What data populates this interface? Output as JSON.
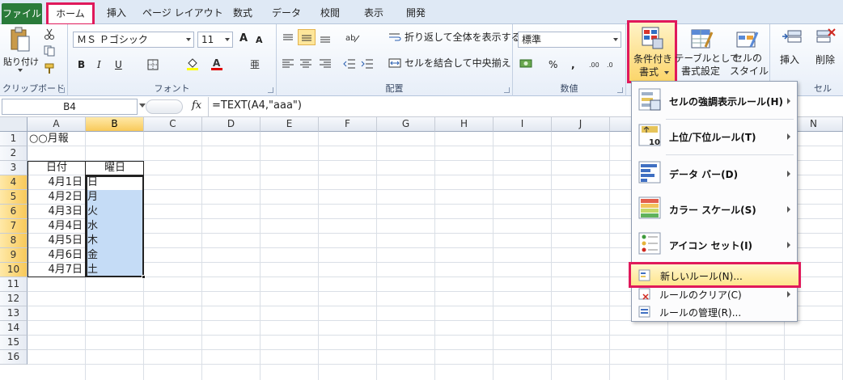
{
  "tabs": [
    "ファイル",
    "ホーム",
    "挿入",
    "ページ レイアウト",
    "数式",
    "データ",
    "校閲",
    "表示",
    "開発"
  ],
  "ribbon": {
    "clipboard": {
      "paste": "貼り付け",
      "label": "クリップボード"
    },
    "font": {
      "name": "ＭＳ Ｐゴシック",
      "size": "11",
      "label": "フォント",
      "bold": "B",
      "italic": "I",
      "underline": "U",
      "grow": "A",
      "shrink": "A"
    },
    "alignment": {
      "wrap": "折り返して全体を表示する",
      "merge": "セルを結合して中央揃え",
      "label": "配置"
    },
    "number": {
      "format": "標準",
      "label": "数値",
      "percent": "%",
      "comma": ","
    },
    "styles": {
      "conditional": [
        "条件付き",
        "書式"
      ],
      "table": [
        "テーブルとして",
        "書式設定"
      ],
      "cell": [
        "セルの",
        "スタイル"
      ]
    },
    "cells": {
      "insert": "挿入",
      "delete": "削除",
      "label": "セル"
    }
  },
  "formula_bar": {
    "name_box": "B4",
    "fx": "fx",
    "formula": "=TEXT(A4,\"aaa\")"
  },
  "columns": [
    "A",
    "B",
    "C",
    "D",
    "E",
    "F",
    "G",
    "H",
    "I",
    "J",
    "K",
    "L",
    "M",
    "N"
  ],
  "rows": [
    "1",
    "2",
    "3",
    "4",
    "5",
    "6",
    "7",
    "8",
    "9",
    "10",
    "11",
    "12",
    "13",
    "14",
    "15",
    "16"
  ],
  "sheet": {
    "title": "○○月報",
    "header_date": "日付",
    "header_day": "曜日",
    "dates": [
      "4月1日",
      "4月2日",
      "4月3日",
      "4月4日",
      "4月5日",
      "4月6日",
      "4月7日"
    ],
    "days": [
      "日",
      "月",
      "火",
      "水",
      "木",
      "金",
      "土"
    ]
  },
  "menu": {
    "items": [
      "セルの強調表示ルール(H)",
      "上位/下位ルール(T)",
      "データ バー(D)",
      "カラー スケール(S)",
      "アイコン セット(I)"
    ],
    "new_rule": "新しいルール(N)...",
    "clear_rule": "ルールのクリア(C)",
    "manage_rule": "ルールの管理(R)..."
  },
  "colors": {
    "accent": "#e0195b",
    "selection": "#c5dcf6",
    "file_tab": "#2a7b3a"
  }
}
